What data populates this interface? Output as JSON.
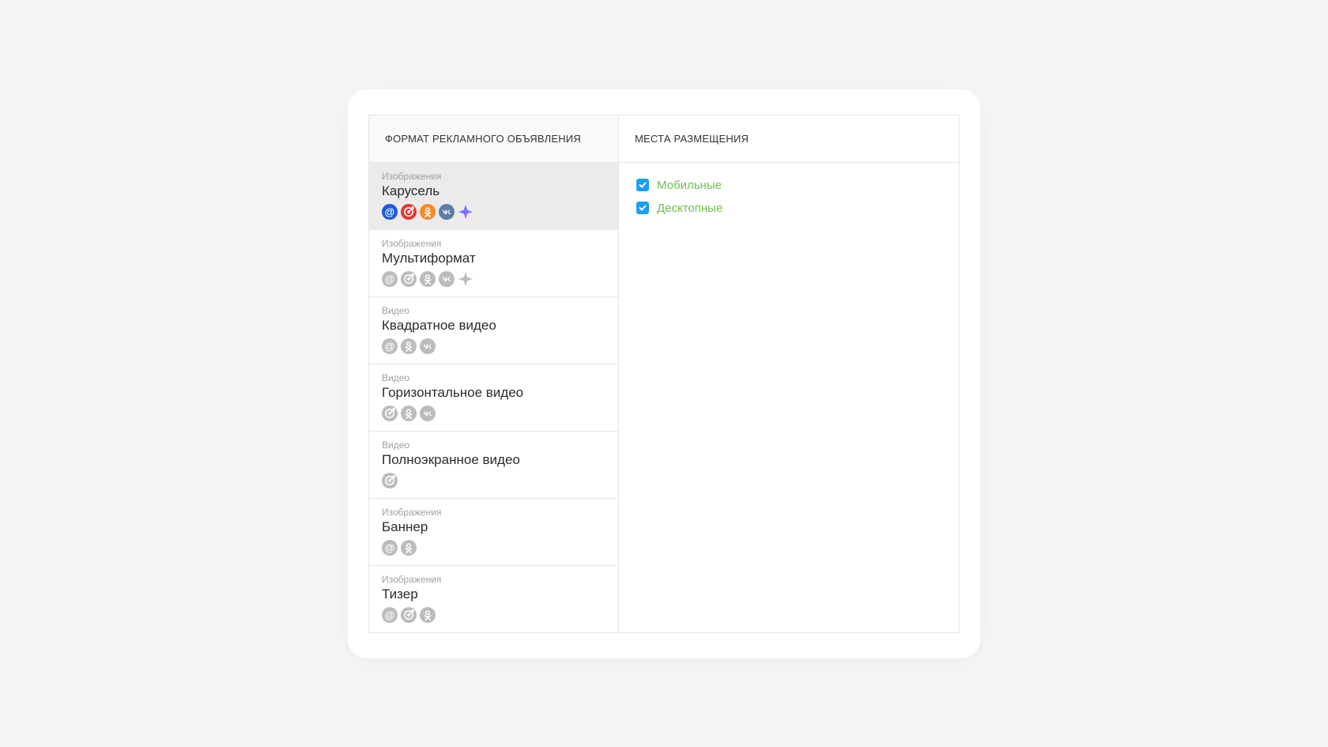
{
  "headers": {
    "left": "ФОРМАТ РЕКЛАМНОГО ОБЪЯВЛЕНИЯ",
    "right": "МЕСТА РАЗМЕЩЕНИЯ"
  },
  "categories": {
    "images": "Изображения",
    "video": "Видео"
  },
  "formats": [
    {
      "category_key": "images",
      "title": "Карусель",
      "selected": true,
      "icons": [
        "at",
        "target",
        "ok",
        "vk",
        "sparkle"
      ]
    },
    {
      "category_key": "images",
      "title": "Мультиформат",
      "selected": false,
      "icons": [
        "at",
        "target",
        "ok",
        "vk",
        "sparkle"
      ]
    },
    {
      "category_key": "video",
      "title": "Квадратное видео",
      "selected": false,
      "icons": [
        "at",
        "ok",
        "vk"
      ]
    },
    {
      "category_key": "video",
      "title": "Горизонтальное видео",
      "selected": false,
      "icons": [
        "target",
        "ok",
        "vk"
      ]
    },
    {
      "category_key": "video",
      "title": "Полноэкранное видео",
      "selected": false,
      "icons": [
        "target"
      ]
    },
    {
      "category_key": "images",
      "title": "Баннер",
      "selected": false,
      "icons": [
        "at",
        "ok"
      ]
    },
    {
      "category_key": "images",
      "title": "Тизер",
      "selected": false,
      "icons": [
        "at",
        "target",
        "ok"
      ]
    }
  ],
  "icon_palette": {
    "colored": {
      "at": "#1d5ade",
      "target": "#e8352e",
      "ok": "#f58b29",
      "vk": "#5e7ea5"
    },
    "muted": "#bcbcbc",
    "sparkle_colored": [
      "#3a7cff",
      "#c85cff"
    ],
    "sparkle_muted": "#bcbcbc"
  },
  "placements": [
    {
      "label": "Мобильные",
      "checked": true
    },
    {
      "label": "Десктопные",
      "checked": true
    }
  ]
}
